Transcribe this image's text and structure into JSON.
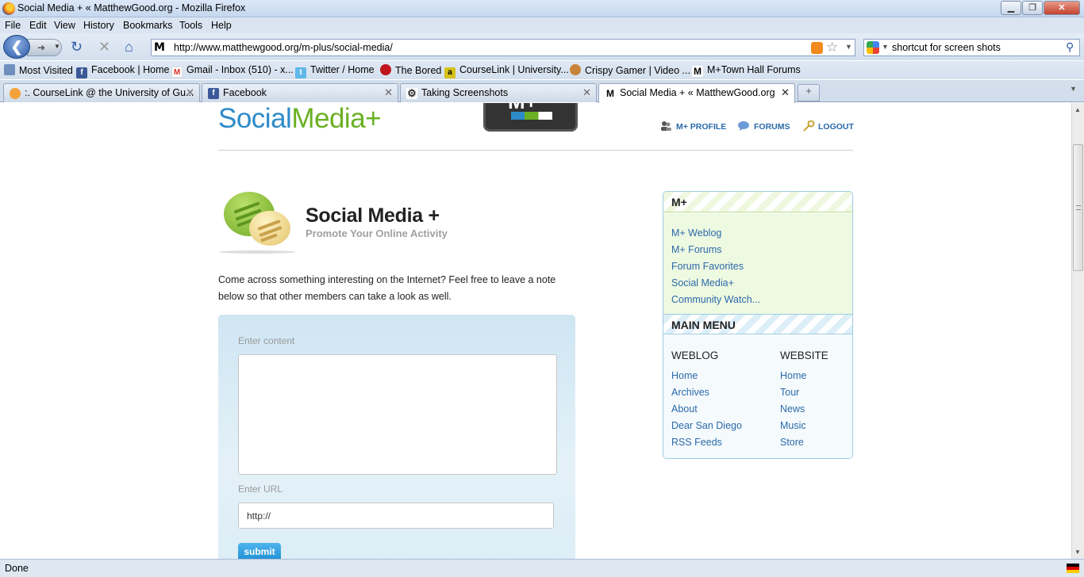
{
  "window": {
    "title": "Social Media + « MatthewGood.org - Mozilla Firefox",
    "minimize": "▁",
    "maximize": "❐",
    "close": "✕"
  },
  "menu": [
    "File",
    "Edit",
    "View",
    "History",
    "Bookmarks",
    "Tools",
    "Help"
  ],
  "nav": {
    "url": "http://www.matthewgood.org/m-plus/social-media/",
    "search_value": "shortcut for screen shots"
  },
  "bookmarks": [
    {
      "label": "Most Visited",
      "icon": "most-visited-icon"
    },
    {
      "label": "Facebook | Home",
      "icon": "facebook-icon"
    },
    {
      "label": "Gmail - Inbox (510) - x...",
      "icon": "gmail-icon"
    },
    {
      "label": "Twitter / Home",
      "icon": "twitter-icon"
    },
    {
      "label": "The Bored",
      "icon": "bored-icon"
    },
    {
      "label": "CourseLink | University...",
      "icon": "courselink-icon"
    },
    {
      "label": "Crispy Gamer | Video ...",
      "icon": "crispy-gamer-icon"
    },
    {
      "label": "M+Town Hall Forums",
      "icon": "m-icon"
    }
  ],
  "tabs": [
    {
      "label": ":. CourseLink @ the University of Gu...",
      "active": false
    },
    {
      "label": "Facebook",
      "active": false
    },
    {
      "label": "Taking Screenshots",
      "active": false
    },
    {
      "label": "Social Media + « MatthewGood.org",
      "active": true
    }
  ],
  "page": {
    "logo_part1": "Social",
    "logo_part2": "Media+",
    "badge_text": "M+",
    "top_nav": [
      "M+ PROFILE",
      "FORUMS",
      "LOGOUT"
    ],
    "title": "Social Media +",
    "subtitle": "Promote Your Online Activity",
    "intro": "Come across something interesting on the Internet? Feel free to leave a note below so that other members can take a look as well.",
    "form": {
      "content_label": "Enter content",
      "content_value": "",
      "url_label": "Enter URL",
      "url_value": "http://",
      "submit_label": "submit"
    }
  },
  "sidebar": {
    "mplus_title": "M+",
    "mplus_links": [
      "M+ Weblog",
      "M+ Forums",
      "Forum Favorites",
      "Social Media+",
      "Community Watch..."
    ],
    "main_menu_title": "MAIN MENU",
    "weblog_title": "WEBLOG",
    "weblog_links": [
      "Home",
      "Archives",
      "About",
      "Dear San Diego",
      "RSS Feeds"
    ],
    "website_title": "WEBSITE",
    "website_links": [
      "Home",
      "Tour",
      "News",
      "Music",
      "Store"
    ]
  },
  "status": {
    "text": "Done"
  },
  "colors": {
    "link": "#2b6aa8",
    "logo_blue": "#2e8bc9",
    "logo_green": "#6ab023",
    "submit": "#1a8bd0"
  }
}
